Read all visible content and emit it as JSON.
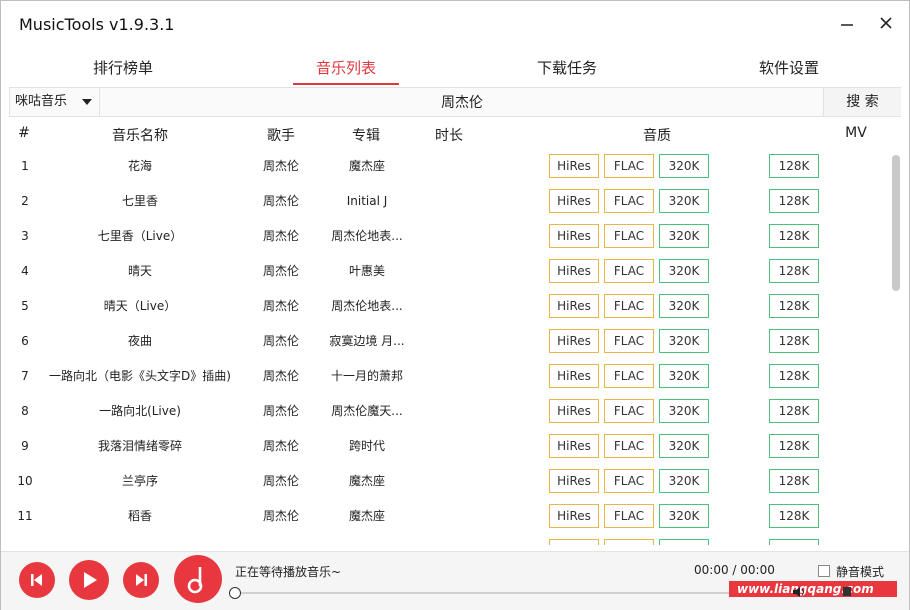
{
  "app": {
    "title": "MusicTools v1.9.3.1"
  },
  "tabs": [
    {
      "label": "排行榜单",
      "active": false
    },
    {
      "label": "音乐列表",
      "active": true
    },
    {
      "label": "下载任务",
      "active": false
    },
    {
      "label": "软件设置",
      "active": false
    }
  ],
  "search": {
    "source": "咪咕音乐",
    "query": "周杰伦",
    "button_label": "搜 索"
  },
  "columns": {
    "index": "#",
    "name": "音乐名称",
    "singer": "歌手",
    "album": "专辑",
    "duration": "时长",
    "quality": "音质",
    "mv": "MV"
  },
  "quality_labels": {
    "hires": "HiRes",
    "flac": "FLAC",
    "q320": "320K",
    "q128": "128K"
  },
  "songs": [
    {
      "index": "1",
      "name": "花海",
      "singer": "周杰伦",
      "album": "魔杰座",
      "duration": ""
    },
    {
      "index": "2",
      "name": "七里香",
      "singer": "周杰伦",
      "album": "Initial J",
      "duration": ""
    },
    {
      "index": "3",
      "name": "七里香（Live）",
      "singer": "周杰伦",
      "album": "周杰伦地表...",
      "duration": ""
    },
    {
      "index": "4",
      "name": "晴天",
      "singer": "周杰伦",
      "album": "叶惠美",
      "duration": ""
    },
    {
      "index": "5",
      "name": "晴天（Live）",
      "singer": "周杰伦",
      "album": "周杰伦地表...",
      "duration": ""
    },
    {
      "index": "6",
      "name": "夜曲",
      "singer": "周杰伦",
      "album": "寂寞边境 月...",
      "duration": ""
    },
    {
      "index": "7",
      "name": "一路向北（电影《头文字D》插曲)",
      "singer": "周杰伦",
      "album": "十一月的萧邦",
      "duration": ""
    },
    {
      "index": "8",
      "name": "一路向北(Live)",
      "singer": "周杰伦",
      "album": "周杰伦魔天...",
      "duration": ""
    },
    {
      "index": "9",
      "name": "我落泪情绪零碎",
      "singer": "周杰伦",
      "album": "跨时代",
      "duration": ""
    },
    {
      "index": "10",
      "name": "兰亭序",
      "singer": "周杰伦",
      "album": "魔杰座",
      "duration": ""
    },
    {
      "index": "11",
      "name": "稻香",
      "singer": "周杰伦",
      "album": "魔杰座",
      "duration": ""
    }
  ],
  "player": {
    "status": "正在等待播放音乐~",
    "time": "00:00 / 00:00",
    "mute_label": "静音模式",
    "progress": 0,
    "volume_icon": "speaker-icon"
  },
  "watermark": "www.liangqang.com",
  "colors": {
    "accent": "#e8373e",
    "hires_border": "#e6b84a",
    "lossy_border": "#4cbf7a"
  }
}
